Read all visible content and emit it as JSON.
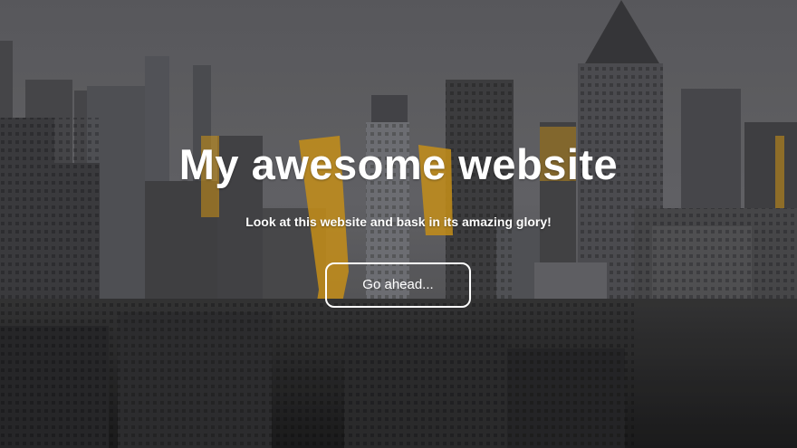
{
  "hero": {
    "title": "My awesome website",
    "subtitle": "Look at this website and bask in its amazing glory!",
    "button_label": "Go ahead..."
  },
  "background": {
    "description_icon": "city-skyline-photo",
    "sky_color": "#6f6f73",
    "building_color": "#3b3b3d",
    "accent_color": "#e0a21c"
  }
}
